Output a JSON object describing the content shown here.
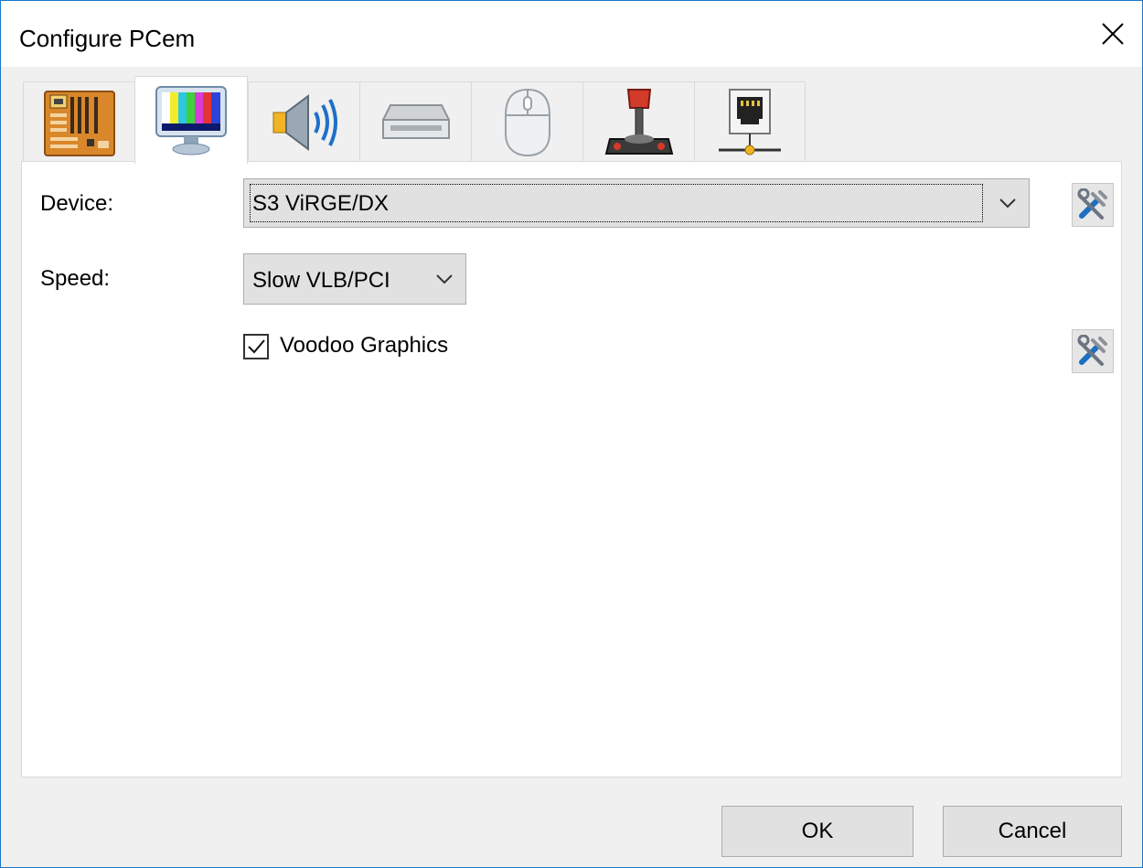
{
  "window": {
    "title": "Configure PCem"
  },
  "tabs": [
    {
      "name": "motherboard",
      "icon": "motherboard-icon"
    },
    {
      "name": "display",
      "icon": "monitor-icon",
      "active": true
    },
    {
      "name": "sound",
      "icon": "speaker-icon"
    },
    {
      "name": "drives",
      "icon": "drive-icon"
    },
    {
      "name": "mouse",
      "icon": "mouse-icon"
    },
    {
      "name": "joystick",
      "icon": "joystick-icon"
    },
    {
      "name": "network",
      "icon": "network-icon"
    }
  ],
  "display": {
    "device_label": "Device:",
    "device_value": "S3 ViRGE/DX",
    "speed_label": "Speed:",
    "speed_value": "Slow VLB/PCI",
    "voodoo_label": "Voodoo Graphics",
    "voodoo_checked": true
  },
  "buttons": {
    "ok": "OK",
    "cancel": "Cancel"
  },
  "colors": {
    "accent_border": "#1979ca",
    "face": "#f0f0f0",
    "button_face": "#e1e1e1"
  }
}
